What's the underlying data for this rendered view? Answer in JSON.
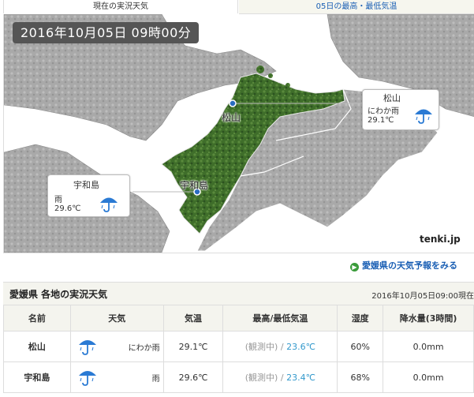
{
  "tabs": {
    "current": "現在の実況天気",
    "other": "05日の最高・最低気温"
  },
  "map": {
    "timestamp": "2016年10月05日 09時00分",
    "cities": [
      {
        "name": "松山",
        "weather": "にわか雨",
        "temp": "29.1℃",
        "icon": "umbrella-rain-icon"
      },
      {
        "name": "宇和島",
        "weather": "雨",
        "temp": "29.6℃",
        "icon": "umbrella-rain-icon"
      }
    ],
    "logo": "tenki.jp"
  },
  "forecast_link": "愛媛県の天気予報をみる",
  "observations": {
    "title": "愛媛県 各地の実況天気",
    "time": "2016年10月05日09:00現在",
    "headers": [
      "名前",
      "天気",
      "気温",
      "最高/最低気温",
      "湿度",
      "降水量(3時間)"
    ],
    "rows": [
      {
        "name": "松山",
        "weather": "にわか雨",
        "temp": "29.1℃",
        "max": "(観測中)",
        "sep": "/",
        "min": "23.6℃",
        "humidity": "60%",
        "precip": "0.0mm"
      },
      {
        "name": "宇和島",
        "weather": "雨",
        "temp": "29.6℃",
        "max": "(観測中)",
        "sep": "/",
        "min": "23.4℃",
        "humidity": "68%",
        "precip": "0.0mm"
      }
    ]
  },
  "colors": {
    "link": "#1a5fb4",
    "min_temp": "#3399cc",
    "land_green": "#3f6e2a",
    "land_gray": "#a8a8a8",
    "sea": "#ffffff"
  }
}
